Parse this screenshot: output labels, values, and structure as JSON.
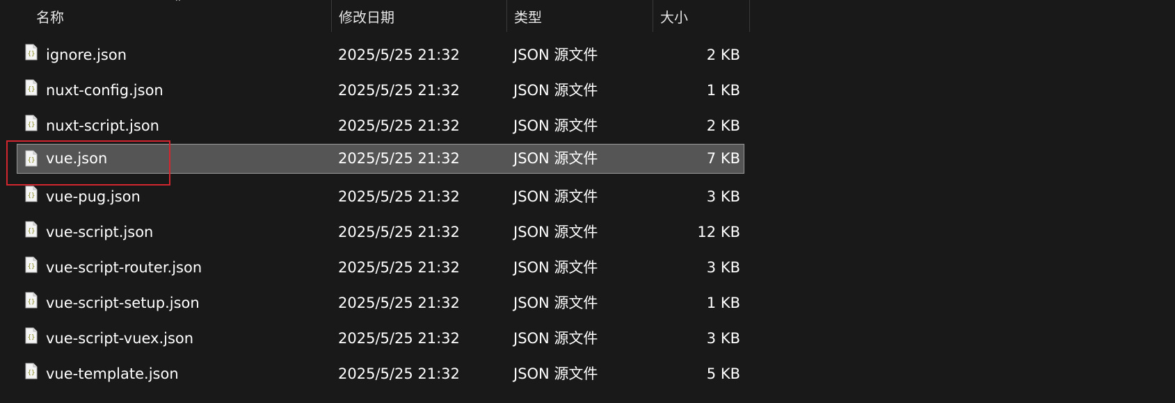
{
  "columns": {
    "name": "名称",
    "date": "修改日期",
    "type": "类型",
    "size": "大小"
  },
  "sort_indicator_icon": "caret-up-icon",
  "file_icon": "json-file-icon",
  "colors": {
    "background": "#191919",
    "selection": "#555555",
    "highlight_border": "#d3262e"
  },
  "files": [
    {
      "name": "ignore.json",
      "date": "2025/5/25 21:32",
      "type": "JSON 源文件",
      "size": "2 KB"
    },
    {
      "name": "nuxt-config.json",
      "date": "2025/5/25 21:32",
      "type": "JSON 源文件",
      "size": "1 KB"
    },
    {
      "name": "nuxt-script.json",
      "date": "2025/5/25 21:32",
      "type": "JSON 源文件",
      "size": "2 KB"
    },
    {
      "name": "vue.json",
      "date": "2025/5/25 21:32",
      "type": "JSON 源文件",
      "size": "7 KB",
      "selected": true
    },
    {
      "name": "vue-pug.json",
      "date": "2025/5/25 21:32",
      "type": "JSON 源文件",
      "size": "3 KB"
    },
    {
      "name": "vue-script.json",
      "date": "2025/5/25 21:32",
      "type": "JSON 源文件",
      "size": "12 KB"
    },
    {
      "name": "vue-script-router.json",
      "date": "2025/5/25 21:32",
      "type": "JSON 源文件",
      "size": "3 KB"
    },
    {
      "name": "vue-script-setup.json",
      "date": "2025/5/25 21:32",
      "type": "JSON 源文件",
      "size": "1 KB"
    },
    {
      "name": "vue-script-vuex.json",
      "date": "2025/5/25 21:32",
      "type": "JSON 源文件",
      "size": "3 KB"
    },
    {
      "name": "vue-template.json",
      "date": "2025/5/25 21:32",
      "type": "JSON 源文件",
      "size": "5 KB"
    }
  ]
}
